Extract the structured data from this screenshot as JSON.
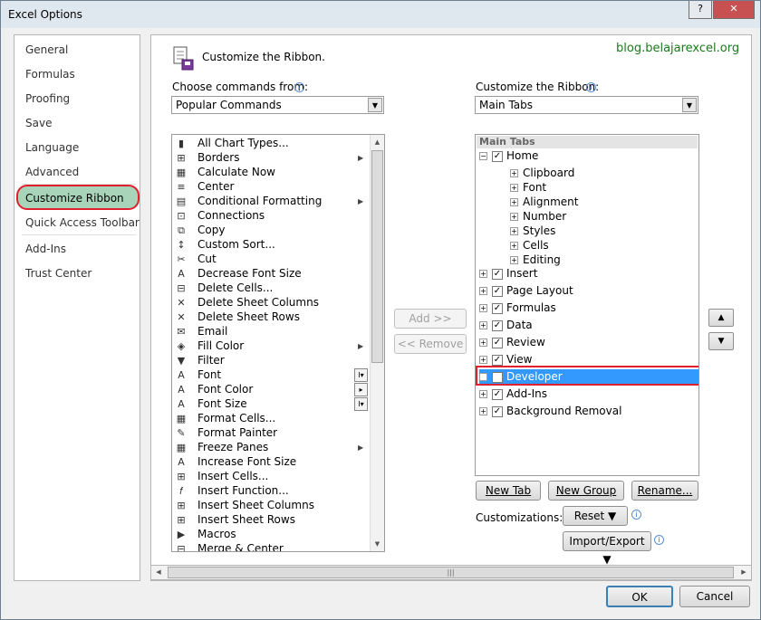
{
  "window": {
    "title": "Excel Options",
    "help_label": "?",
    "close_label": "✕"
  },
  "nav": {
    "items": [
      {
        "label": "General"
      },
      {
        "label": "Formulas"
      },
      {
        "label": "Proofing"
      },
      {
        "label": "Save"
      },
      {
        "label": "Language"
      },
      {
        "label": "Advanced"
      },
      {
        "label": "Customize Ribbon"
      },
      {
        "label": "Quick Access Toolbar"
      },
      {
        "label": "Add-Ins"
      },
      {
        "label": "Trust Center"
      }
    ]
  },
  "header": {
    "title": "Customize the Ribbon.",
    "watermark": "blog.belajarexcel.org"
  },
  "left": {
    "choose_label": "Choose commands from:",
    "choose_value": "Popular Commands",
    "commands": [
      {
        "label": "All Chart Types...",
        "icon": "chart-icon"
      },
      {
        "label": "Borders",
        "icon": "borders-icon"
      },
      {
        "label": "Calculate Now",
        "icon": "calculator-icon"
      },
      {
        "label": "Center",
        "icon": "center-icon"
      },
      {
        "label": "Conditional Formatting",
        "icon": "conditional-formatting-icon"
      },
      {
        "label": "Connections",
        "icon": "connections-icon"
      },
      {
        "label": "Copy",
        "icon": "copy-icon"
      },
      {
        "label": "Custom Sort...",
        "icon": "sort-icon"
      },
      {
        "label": "Cut",
        "icon": "scissors-icon"
      },
      {
        "label": "Decrease Font Size",
        "icon": "decrease-font-icon"
      },
      {
        "label": "Delete Cells...",
        "icon": "delete-cells-icon"
      },
      {
        "label": "Delete Sheet Columns",
        "icon": "delete-columns-icon"
      },
      {
        "label": "Delete Sheet Rows",
        "icon": "delete-rows-icon"
      },
      {
        "label": "Email",
        "icon": "email-icon"
      },
      {
        "label": "Fill Color",
        "icon": "fill-color-icon"
      },
      {
        "label": "Filter",
        "icon": "filter-icon"
      },
      {
        "label": "Font",
        "icon": "font-icon"
      },
      {
        "label": "Font Color",
        "icon": "font-color-icon"
      },
      {
        "label": "Font Size",
        "icon": "font-size-icon"
      },
      {
        "label": "Format Cells...",
        "icon": "format-cells-icon"
      },
      {
        "label": "Format Painter",
        "icon": "format-painter-icon"
      },
      {
        "label": "Freeze Panes",
        "icon": "freeze-panes-icon"
      },
      {
        "label": "Increase Font Size",
        "icon": "increase-font-icon"
      },
      {
        "label": "Insert Cells...",
        "icon": "insert-cells-icon"
      },
      {
        "label": "Insert Function...",
        "icon": "function-icon"
      },
      {
        "label": "Insert Sheet Columns",
        "icon": "insert-columns-icon"
      },
      {
        "label": "Insert Sheet Rows",
        "icon": "insert-rows-icon"
      },
      {
        "label": "Macros",
        "icon": "macros-icon"
      },
      {
        "label": "Merge & Center",
        "icon": "merge-center-icon"
      }
    ],
    "icon_glyphs": [
      "▮",
      "⊞",
      "▦",
      "≡",
      "▤",
      "⊡",
      "⧉",
      "↕",
      "✂",
      "A",
      "⊟",
      "✕",
      "✕",
      "✉",
      "◈",
      "▼",
      "A",
      "A",
      "A",
      "▦",
      "✎",
      "▦",
      "A",
      "⊞",
      "𝑓",
      "⊞",
      "⊞",
      "▶",
      "⊟"
    ]
  },
  "middle": {
    "add_label": "Add >>",
    "remove_label": "<< Remove"
  },
  "right": {
    "customize_label": "Customize the Ribbon:",
    "customize_value": "Main Tabs",
    "tree_header": "Main Tabs",
    "home": {
      "label": "Home",
      "groups": [
        "Clipboard",
        "Font",
        "Alignment",
        "Number",
        "Styles",
        "Cells",
        "Editing"
      ]
    },
    "tabs": [
      {
        "label": "Insert"
      },
      {
        "label": "Page Layout"
      },
      {
        "label": "Formulas"
      },
      {
        "label": "Data"
      },
      {
        "label": "Review"
      },
      {
        "label": "View"
      },
      {
        "label": "Developer"
      },
      {
        "label": "Add-Ins"
      },
      {
        "label": "Background Removal"
      }
    ],
    "new_tab_label": "New Tab",
    "new_group_label": "New Group",
    "rename_label": "Rename...",
    "customizations_label": "Customizations:",
    "reset_label": "Reset ▼",
    "import_export_label": "Import/Export ▼"
  },
  "footer": {
    "ok_label": "OK",
    "cancel_label": "Cancel"
  },
  "colors": {
    "highlight": "#3399ff",
    "annotation": "#e0202f",
    "nav_selected": "#a8d4b9"
  }
}
